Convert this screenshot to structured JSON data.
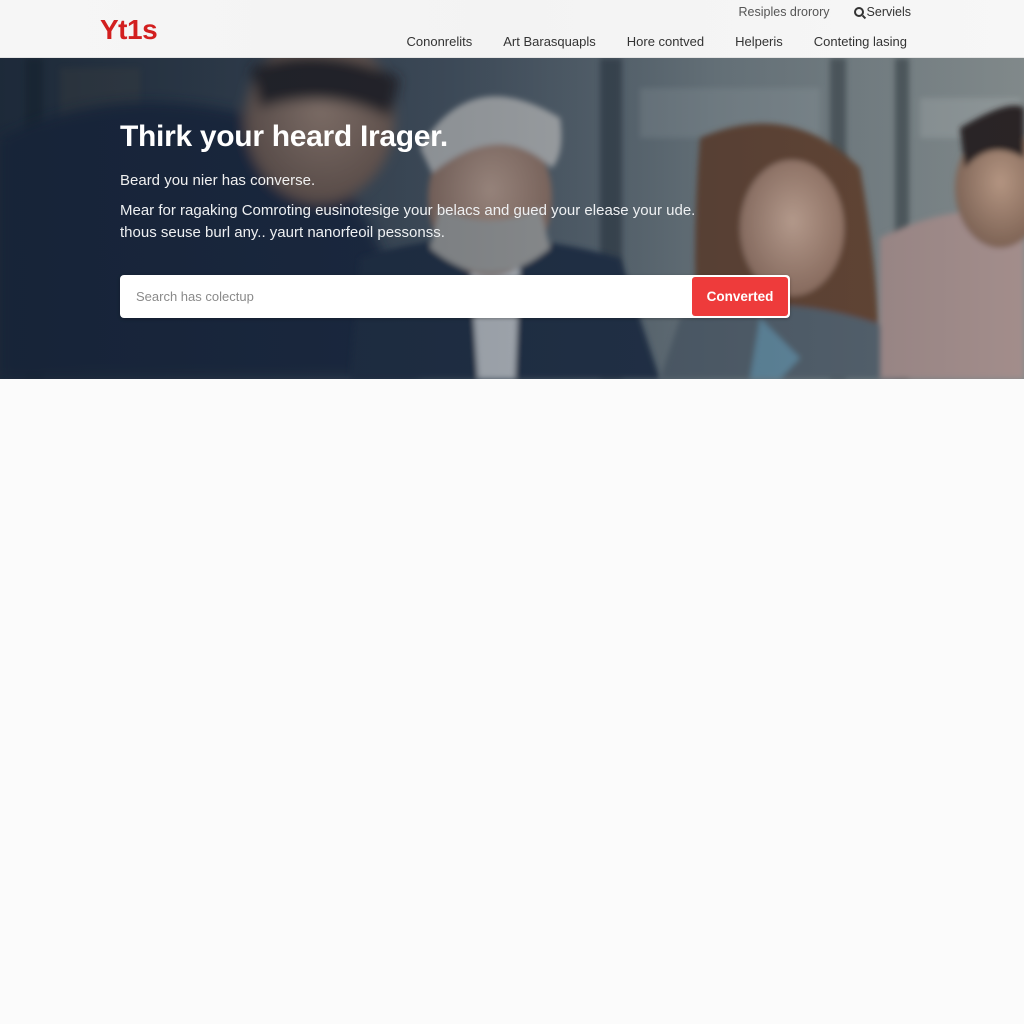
{
  "header": {
    "logo": "Yt1s",
    "utility_links": [
      {
        "label": "Resiples drorory"
      },
      {
        "label": "Serviels",
        "icon": "search-icon"
      }
    ],
    "nav": [
      {
        "label": "Cononrelits"
      },
      {
        "label": "Art Barasquapls"
      },
      {
        "label": "Hore contved"
      },
      {
        "label": "Helperis"
      },
      {
        "label": "Conteting lasing"
      }
    ]
  },
  "hero": {
    "title": "Thirk your heard Irager.",
    "subtitle": "Beard you nier has converse.",
    "description": "Mear for ragaking Comroting eusinotesige your belacs and gued your elease your ude. thous seuse burl any.. yaurt nanorfeoil pessonss.",
    "search": {
      "placeholder": "Search has colectup",
      "value": "",
      "button_label": "Converted"
    }
  },
  "colors": {
    "brand": "#d21f1f",
    "button": "#ee3b3b",
    "header_bg": "#f5f5f5",
    "page_bg": "#fbfbfb"
  }
}
